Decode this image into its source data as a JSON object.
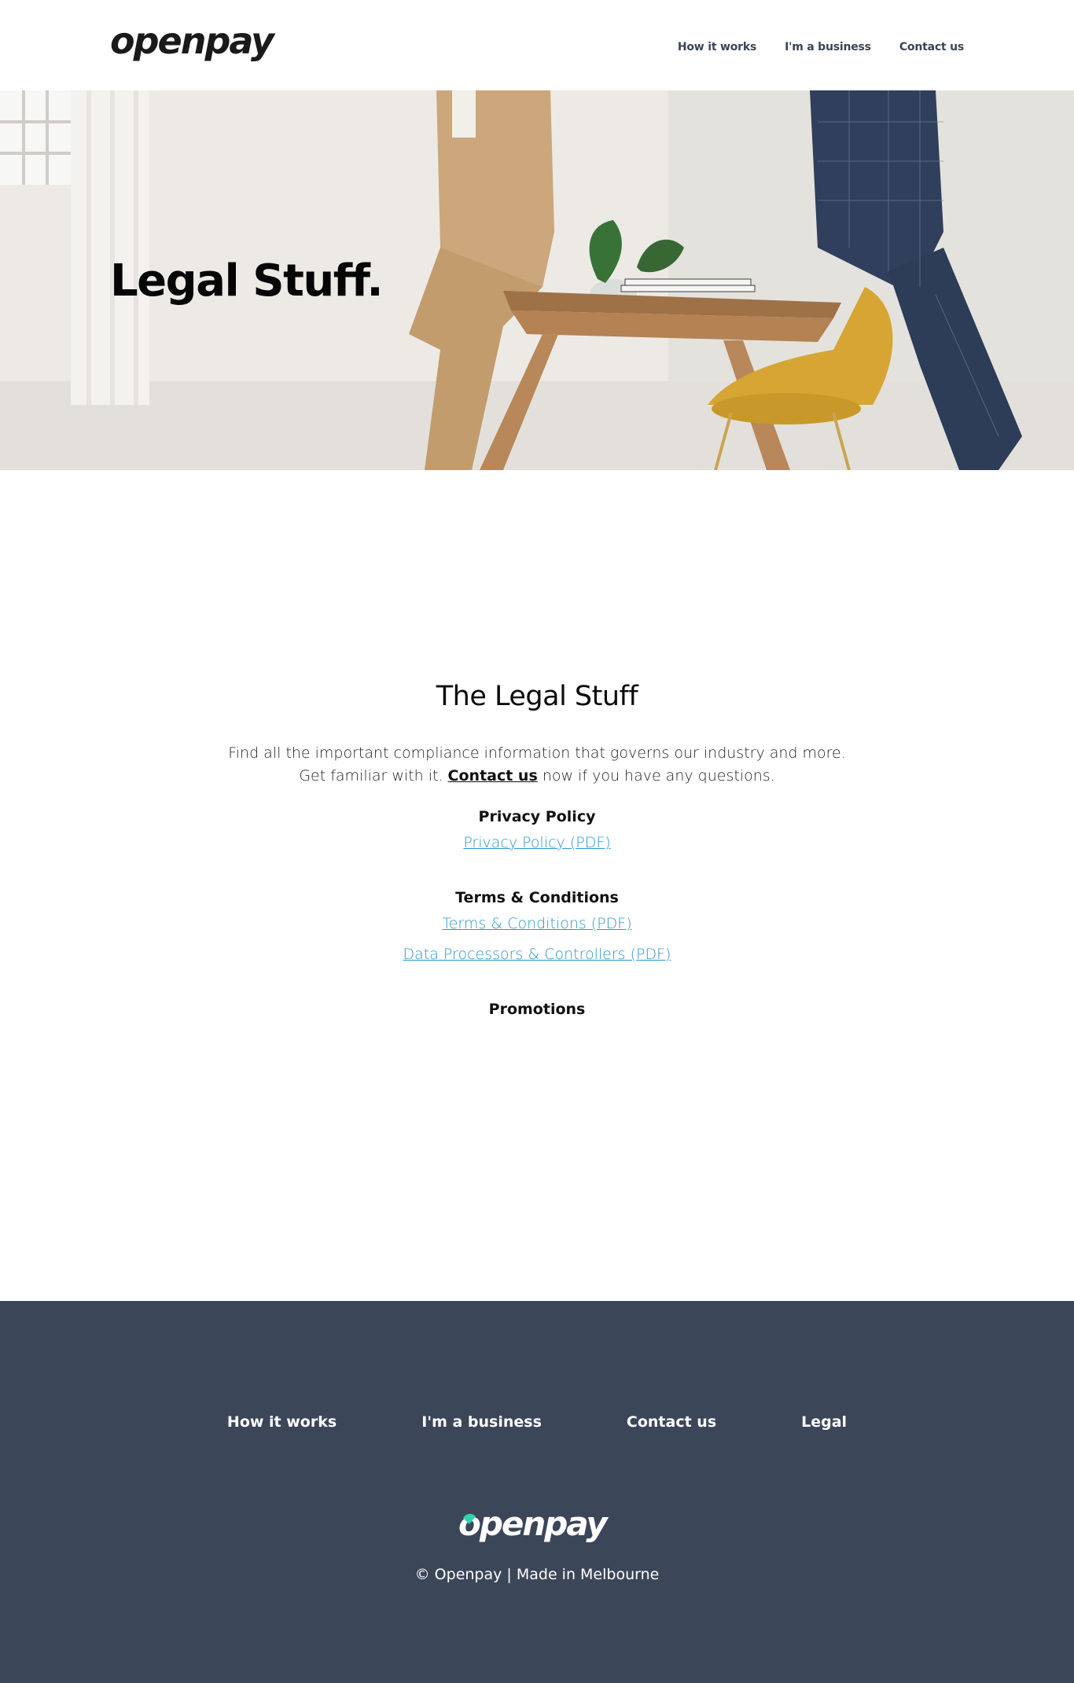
{
  "brand": {
    "name": "openpay",
    "accent_color": "#2fd3b0"
  },
  "header": {
    "nav": [
      {
        "label": "How it works"
      },
      {
        "label": "I'm a business"
      },
      {
        "label": "Contact us"
      }
    ]
  },
  "hero": {
    "title": "Legal Stuff."
  },
  "main": {
    "title": "The Legal Stuff",
    "intro_line1": "Find all the important compliance information that governs our industry and more.",
    "intro_line2_before": "Get familiar with it. ",
    "intro_link": "Contact us",
    "intro_line2_after": " now if you have any questions.",
    "sections": [
      {
        "heading": "Privacy Policy",
        "links": [
          "Privacy Policy (PDF)"
        ]
      },
      {
        "heading": "Terms & Conditions",
        "links": [
          "Terms & Conditions (PDF)",
          "Data Processors & Controllers (PDF)"
        ]
      },
      {
        "heading": "Promotions",
        "links": []
      }
    ],
    "link_color": "#2b97c8"
  },
  "footer": {
    "nav": [
      {
        "label": "How it works"
      },
      {
        "label": "I'm a business"
      },
      {
        "label": "Contact us"
      },
      {
        "label": "Legal"
      }
    ],
    "copyright": "© Openpay | Made in Melbourne",
    "background": "#3c4659"
  }
}
